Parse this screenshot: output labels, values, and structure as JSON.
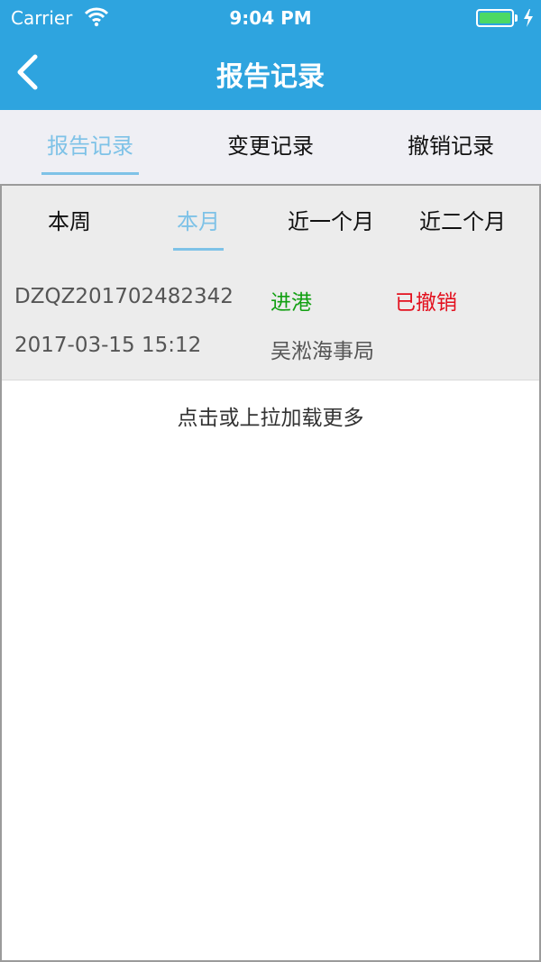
{
  "status_bar": {
    "carrier": "Carrier",
    "time": "9:04 PM",
    "battery_level": 1.0,
    "wifi_icon": "wifi-icon",
    "charge_icon": "bolt-icon"
  },
  "nav": {
    "back_icon": "chevron-left-icon",
    "title": "报告记录"
  },
  "main_tabs": [
    {
      "label": "报告记录",
      "active": true
    },
    {
      "label": "变更记录",
      "active": false
    },
    {
      "label": "撤销记录",
      "active": false
    }
  ],
  "period_tabs": [
    {
      "label": "本周",
      "active": false
    },
    {
      "label": "本月",
      "active": true
    },
    {
      "label": "近一个月",
      "active": false
    },
    {
      "label": "近二个月",
      "active": false
    }
  ],
  "records": [
    {
      "id": "DZQZ201702482342",
      "type": "进港",
      "status": "已撤销",
      "datetime": "2017-03-15 15:12",
      "authority": "吴淞海事局"
    }
  ],
  "load_more": "点击或上拉加载更多",
  "colors": {
    "header": "#2ea4df",
    "active_tab": "#7ec2e7",
    "type_text": "#12a012",
    "status_text": "#e3101e",
    "battery": "#4cd964"
  }
}
